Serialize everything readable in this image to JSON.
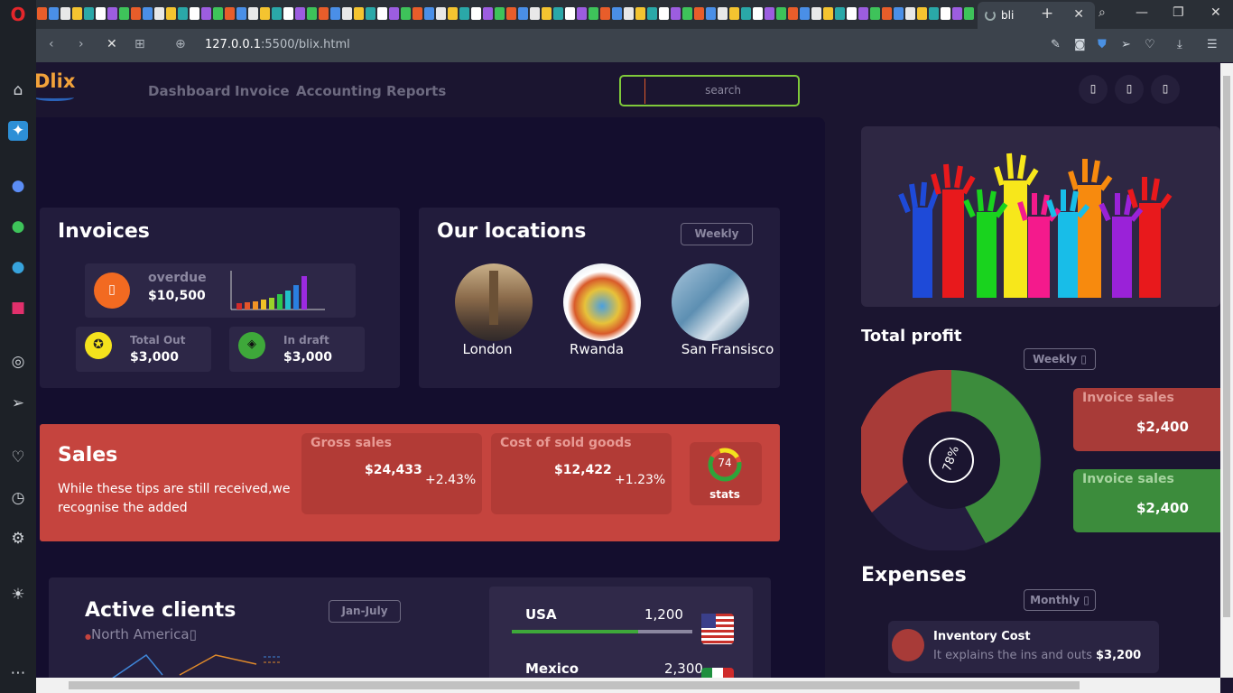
{
  "browser": {
    "tab_title": "bli",
    "url_host": "127.0.0.1",
    "url_rest": ":5500/blix.html",
    "colors": {
      "sidebar": "#1d2127",
      "tabbar": "#2a2f36",
      "addressbar": "#3c434c"
    }
  },
  "app": {
    "logo_text": "Dlix",
    "nav": [
      "Dashboard",
      "Invoice",
      "Accounting",
      "Reports"
    ],
    "search_placeholder": "search",
    "accent": "#7fc93a"
  },
  "invoices": {
    "title": "Invoices",
    "overdue_label": "overdue",
    "overdue_value": "$10,500",
    "total_out_label": "Total Out",
    "total_out_value": "$3,000",
    "in_draft_label": "In draft",
    "in_draft_value": "$3,000"
  },
  "locations": {
    "title": "Our locations",
    "period": "Weekly",
    "items": [
      "London",
      "Rwanda",
      "San Fransisco"
    ]
  },
  "sales": {
    "title": "Sales",
    "text": "While these tips are still received,we recognise the added",
    "gross_label": "Gross sales",
    "gross_value": "$24,433",
    "gross_change": "+2.43%",
    "cogs_label": "Cost of sold goods",
    "cogs_value": "$12,422",
    "cogs_change": "+1.23%",
    "stats_value": "74",
    "stats_label": "stats"
  },
  "clients": {
    "title": "Active clients",
    "region": "North America",
    "period": "Jan-July",
    "countries": [
      {
        "name": "USA",
        "value": "1,200"
      },
      {
        "name": "Mexico",
        "value": "2,300"
      }
    ]
  },
  "profit": {
    "title": "Total profit",
    "period": "Weekly",
    "percent": "78%",
    "invoice_sales_1_label": "Invoice sales",
    "invoice_sales_1_value": "$2,400",
    "invoice_sales_2_label": "Invoice sales",
    "invoice_sales_2_value": "$2,400"
  },
  "expenses": {
    "title": "Expenses",
    "period": "Monthly",
    "item_title": "Inventory Cost",
    "item_text": "It explains the ins and outs",
    "item_value": "$3,200"
  }
}
